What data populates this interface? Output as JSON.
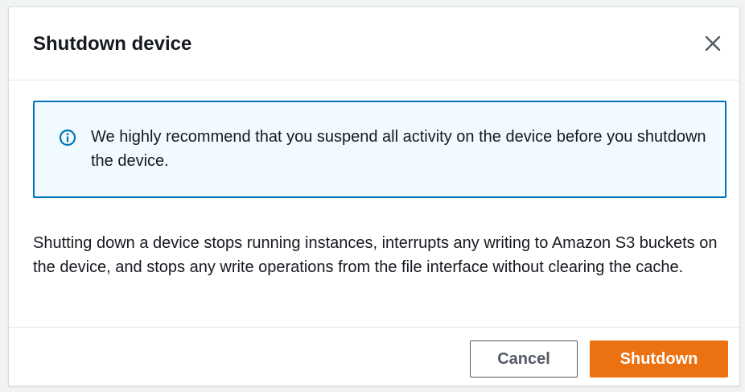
{
  "modal": {
    "title": "Shutdown device",
    "close_icon": "close-icon",
    "alert": {
      "icon": "info-icon",
      "message": "We highly recommend that you suspend all activity on the device before you shutdown the device.",
      "border_color": "#0073bb",
      "background_color": "#f1faff"
    },
    "body_text": "Shutting down a device stops running instances, interrupts any writing to Amazon S3 buckets on the device, and stops any write operations from the file interface without clearing the cache.",
    "footer": {
      "cancel_label": "Cancel",
      "confirm_label": "Shutdown",
      "confirm_color": "#ec7211"
    }
  }
}
